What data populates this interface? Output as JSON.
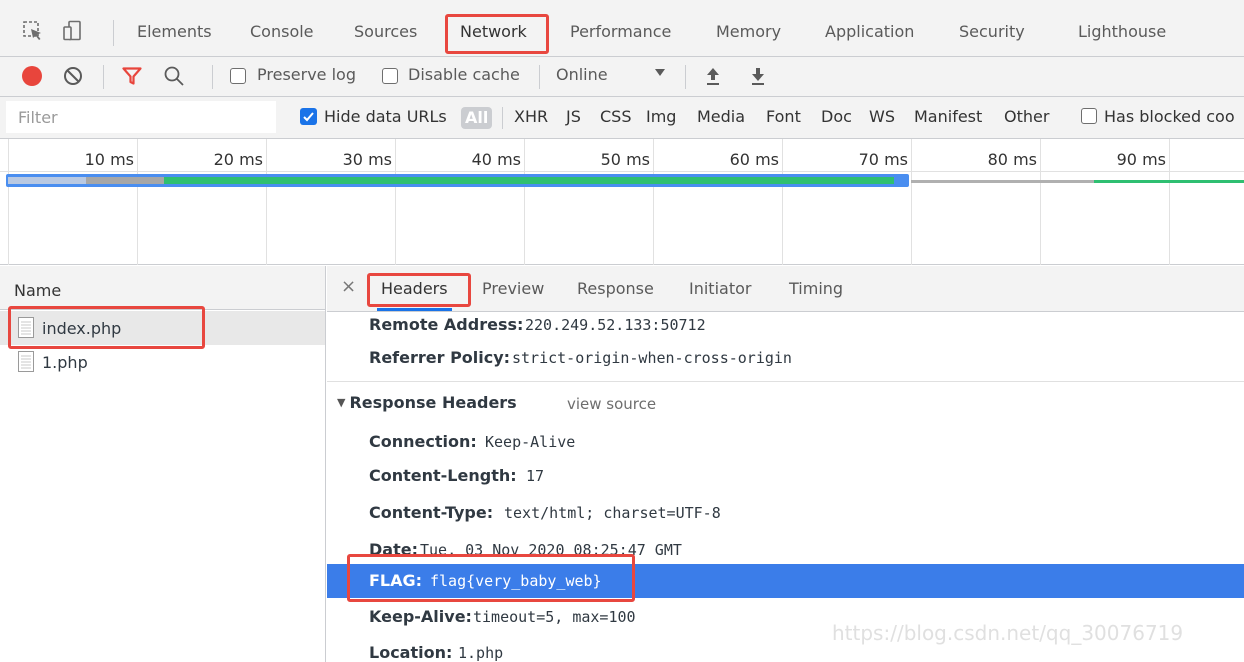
{
  "devtools": {
    "tabs": [
      "Elements",
      "Console",
      "Sources",
      "Network",
      "Performance",
      "Memory",
      "Application",
      "Security",
      "Lighthouse"
    ],
    "active_tab": "Network"
  },
  "toolbar": {
    "preserve_log_label": "Preserve log",
    "preserve_log_checked": false,
    "disable_cache_label": "Disable cache",
    "disable_cache_checked": false,
    "throttling_value": "Online"
  },
  "filter_bar": {
    "filter_placeholder": "Filter",
    "hide_data_urls_label": "Hide data URLs",
    "hide_data_urls_checked": true,
    "types": [
      "All",
      "XHR",
      "JS",
      "CSS",
      "Img",
      "Media",
      "Font",
      "Doc",
      "WS",
      "Manifest",
      "Other"
    ],
    "active_type": "All",
    "has_blocked_label": "Has blocked coo"
  },
  "timeline": {
    "ticks": [
      "10 ms",
      "20 ms",
      "30 ms",
      "40 ms",
      "50 ms",
      "60 ms",
      "70 ms",
      "80 ms",
      "90 ms"
    ]
  },
  "requests": {
    "column_name": "Name",
    "items": [
      {
        "name": "index.php",
        "selected": true
      },
      {
        "name": "1.php",
        "selected": false
      }
    ]
  },
  "details": {
    "tabs": [
      "Headers",
      "Preview",
      "Response",
      "Initiator",
      "Timing"
    ],
    "active_tab": "Headers",
    "general": [
      {
        "key": "Remote Address:",
        "value": "220.249.52.133:50712"
      },
      {
        "key": "Referrer Policy:",
        "value": "strict-origin-when-cross-origin"
      }
    ],
    "response_headers_title": "Response Headers",
    "view_source_label": "view source",
    "response_headers": [
      {
        "key": "Connection:",
        "value": "Keep-Alive"
      },
      {
        "key": "Content-Length:",
        "value": "17"
      },
      {
        "key": "Content-Type:",
        "value": "text/html; charset=UTF-8"
      },
      {
        "key": "Date:",
        "value": "Tue, 03 Nov 2020 08:25:47 GMT"
      },
      {
        "key": "FLAG:",
        "value": "flag{very_baby_web}"
      },
      {
        "key": "Keep-Alive:",
        "value": "timeout=5, max=100"
      },
      {
        "key": "Location:",
        "value": "1.php"
      }
    ]
  },
  "watermark": "https://blog.csdn.net/qq_30076719",
  "colors": {
    "highlight_box": "#e8473f",
    "selection_blue": "#3b7de9",
    "active_tab_underline": "#1a73e8",
    "record_red": "#e8453c"
  }
}
